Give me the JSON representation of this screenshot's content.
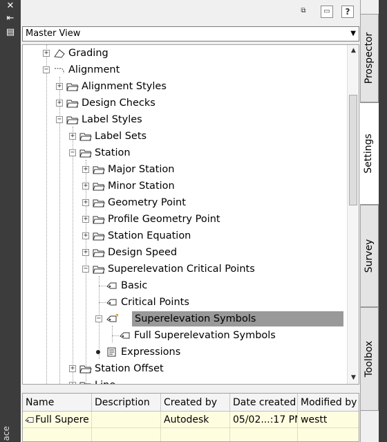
{
  "toolbar": {
    "icons": [
      "tree-toggle-icon",
      "panel-icon",
      "help-icon"
    ],
    "help_label": "?"
  },
  "view_select": {
    "value": "Master View"
  },
  "tree": {
    "items": [
      {
        "label": "Grading"
      },
      {
        "label": "Alignment"
      },
      {
        "label": "Alignment Styles"
      },
      {
        "label": "Design Checks"
      },
      {
        "label": "Label Styles"
      },
      {
        "label": "Label Sets"
      },
      {
        "label": "Station"
      },
      {
        "label": "Major Station"
      },
      {
        "label": "Minor Station"
      },
      {
        "label": "Geometry Point"
      },
      {
        "label": "Profile Geometry Point"
      },
      {
        "label": "Station Equation"
      },
      {
        "label": "Design Speed"
      },
      {
        "label": "Superelevation Critical Points"
      },
      {
        "label": "Basic"
      },
      {
        "label": "Critical Points"
      },
      {
        "label": "Superelevation Symbols"
      },
      {
        "label": "Full Superelevation Symbols"
      },
      {
        "label": "Expressions"
      },
      {
        "label": "Station Offset"
      },
      {
        "label": "Line"
      }
    ]
  },
  "grid": {
    "columns": [
      "Name",
      "Description",
      "Created by",
      "Date created",
      "Modified by"
    ],
    "rows": [
      {
        "name": "Full Supere",
        "description": "",
        "created_by": "Autodesk",
        "date_created": "05/02...:17 PM",
        "modified_by": "westt"
      }
    ]
  },
  "tabs": [
    "Prospector",
    "Settings",
    "Survey",
    "Toolbox"
  ],
  "left_strip": {
    "label": "ace"
  },
  "colors": {
    "selected_row": "#999999",
    "grid_row": "#fffde0",
    "dark_strip": "#3c3c3c"
  }
}
